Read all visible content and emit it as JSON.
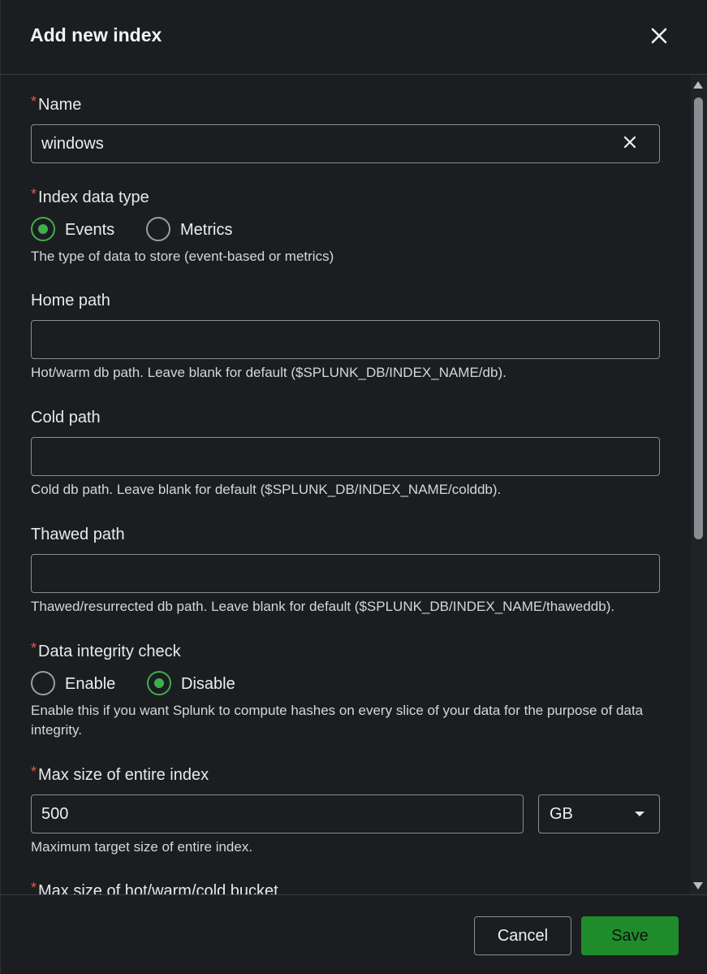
{
  "dialog": {
    "title": "Add new index"
  },
  "name": {
    "label": "Name",
    "value": "windows"
  },
  "data_type": {
    "label": "Index data type",
    "options": [
      "Events",
      "Metrics"
    ],
    "selected": "Events",
    "help": "The type of data to store (event-based or metrics)"
  },
  "home_path": {
    "label": "Home path",
    "value": "",
    "help": "Hot/warm db path. Leave blank for default ($SPLUNK_DB/INDEX_NAME/db)."
  },
  "cold_path": {
    "label": "Cold path",
    "value": "",
    "help": "Cold db path. Leave blank for default ($SPLUNK_DB/INDEX_NAME/colddb)."
  },
  "thawed_path": {
    "label": "Thawed path",
    "value": "",
    "help": "Thawed/resurrected db path. Leave blank for default ($SPLUNK_DB/INDEX_NAME/thaweddb)."
  },
  "integrity": {
    "label": "Data integrity check",
    "options": [
      "Enable",
      "Disable"
    ],
    "selected": "Disable",
    "help": "Enable this if you want Splunk to compute hashes on every slice of your data for the purpose of data integrity."
  },
  "max_size": {
    "label": "Max size of entire index",
    "value": "500",
    "unit": "GB",
    "help": "Maximum target size of entire index."
  },
  "max_bucket": {
    "label": "Max size of hot/warm/cold bucket"
  },
  "required_mark": "*",
  "footer": {
    "cancel_label": "Cancel",
    "save_label": "Save"
  },
  "colors": {
    "accent": "#3fae4a",
    "save": "#1f8c2b",
    "required": "#e0584f",
    "background": "#1b1d21"
  },
  "icons": {
    "close": "close-icon",
    "clear": "clear-icon",
    "caret": "chevron-down-icon"
  }
}
